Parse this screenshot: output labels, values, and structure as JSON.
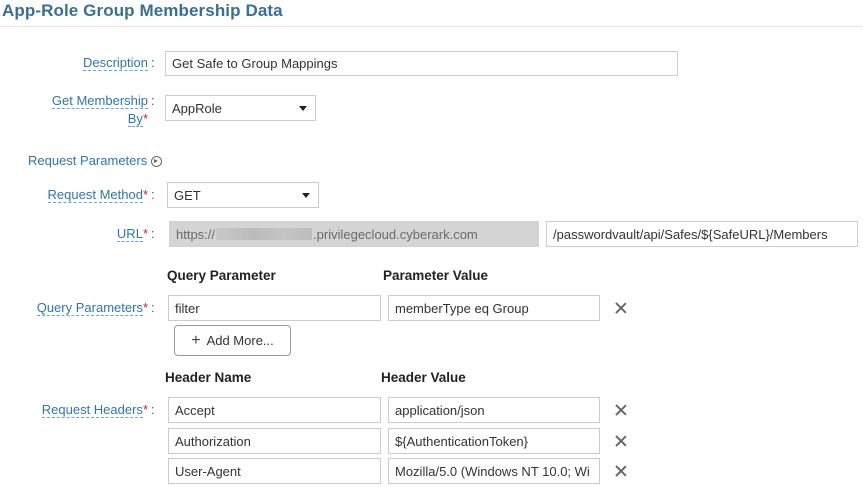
{
  "title": "App-Role Group Membership Data",
  "description": {
    "label": "Description",
    "value": "Get Safe to Group Mappings"
  },
  "membership": {
    "label_line1": "Get Membership",
    "label_line2": "By",
    "required_mark": "*",
    "value": "AppRole"
  },
  "request_parameters": {
    "label": "Request Parameters"
  },
  "request_method": {
    "label": "Request Method",
    "required_mark": "*",
    "value": "GET"
  },
  "url": {
    "label": "URL",
    "required_mark": "*",
    "base_prefix": "https://",
    "base_suffix": ".privilegecloud.cyberark.com",
    "path": "/passwordvault/api/Safes/${SafeURL}/Members"
  },
  "query": {
    "label": "Query Parameters",
    "required_mark": "*",
    "col_param": "Query Parameter",
    "col_value": "Parameter Value",
    "rows": [
      {
        "param": "filter",
        "value": "memberType eq Group"
      }
    ],
    "add_more": "Add More..."
  },
  "headers": {
    "label": "Request Headers",
    "required_mark": "*",
    "col_name": "Header Name",
    "col_value": "Header Value",
    "rows": [
      {
        "name": "Accept",
        "value": "application/json"
      },
      {
        "name": "Authorization",
        "value": "${AuthenticationToken}"
      },
      {
        "name": "User-Agent",
        "value": "Mozilla/5.0 (Windows NT 10.0; Wi"
      }
    ]
  },
  "colon": ":"
}
